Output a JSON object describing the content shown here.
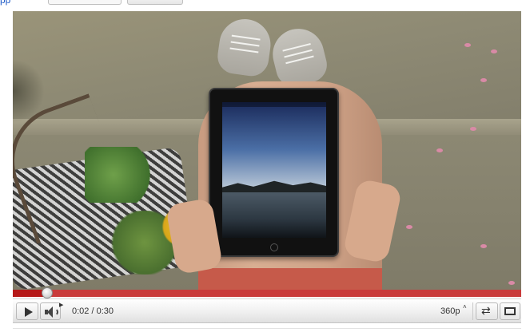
{
  "header": {
    "link_text": "pp",
    "select_value": "",
    "button_label": ""
  },
  "player": {
    "progress_fraction": 0.067,
    "current_time": "0:02",
    "duration": "0:30",
    "time_display": "0:02 / 0:30",
    "quality": "360p",
    "quality_caret": "˄",
    "icons": {
      "play": "play-icon",
      "volume": "volume-icon",
      "repeat": "repeat-icon",
      "fullscreen": "fullscreen-icon"
    },
    "colors": {
      "progress_track": "#c93b3b",
      "progress_played": "#b51818",
      "control_bar": "#eeeeee"
    }
  }
}
